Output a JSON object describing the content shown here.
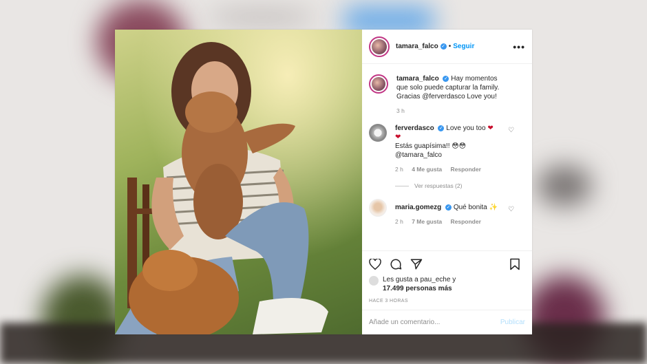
{
  "post": {
    "username": "tamara_falco",
    "verified_mark": "✓",
    "separator": "•",
    "follow_label": "Seguir",
    "more_label": "•••",
    "caption": {
      "username": "tamara_falco",
      "text": "Hay momentos que solo puede capturar la family. Gracias @ferverdasco Love you!",
      "time": "3 h"
    },
    "comments": [
      {
        "username": "ferverdasco",
        "text_line1": "Love you too",
        "text_line2": "Estás guapísima!! 😳😳",
        "text_line3": "@tamara_falco",
        "time": "2 h",
        "likes": "4 Me gusta",
        "reply": "Responder"
      },
      {
        "username": "maria.gomezg",
        "text_line1": "Qué bonita",
        "time": "2 h",
        "likes": "7 Me gusta",
        "reply": "Responder"
      }
    ],
    "view_replies": "Ver respuestas (2)",
    "likes_line1": "Les gusta a pau_eche y",
    "likes_line2": "17.499 personas más",
    "timestamp": "HACE 3 HORAS",
    "comment_placeholder": "Añade un comentario...",
    "publish_label": "Publicar"
  },
  "colors": {
    "link_blue": "#0095f6",
    "verified_blue": "#3897f0",
    "heart_red": "#c8102e",
    "meta_gray": "#8e8e8e"
  },
  "icons": [
    "heart-icon",
    "comment-icon",
    "share-icon",
    "bookmark-icon",
    "more-options-icon",
    "verified-icon"
  ]
}
